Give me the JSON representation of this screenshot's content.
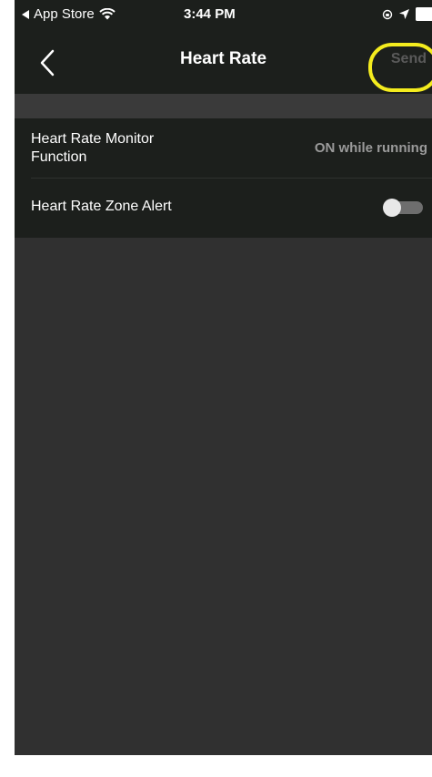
{
  "status_bar": {
    "back_app": "App Store",
    "time": "3:44 PM",
    "wifi_icon": "wifi-icon",
    "location_icon": "location-arrow-icon",
    "lock_rotation_icon": "orientation-lock-icon",
    "battery_icon": "battery-icon"
  },
  "nav": {
    "back_icon": "chevron-left-icon",
    "title": "Heart Rate",
    "send_label": "Send"
  },
  "settings": {
    "items": [
      {
        "label": "Heart Rate Monitor Function",
        "value": "ON while running"
      },
      {
        "label": "Heart Rate Zone Alert",
        "toggle": false
      }
    ]
  },
  "colors": {
    "background": "#303030",
    "header": "#1c1f1c",
    "highlight": "#f4ec1e",
    "send_disabled": "#5a5a5a",
    "value_text": "#9a9a9a"
  }
}
